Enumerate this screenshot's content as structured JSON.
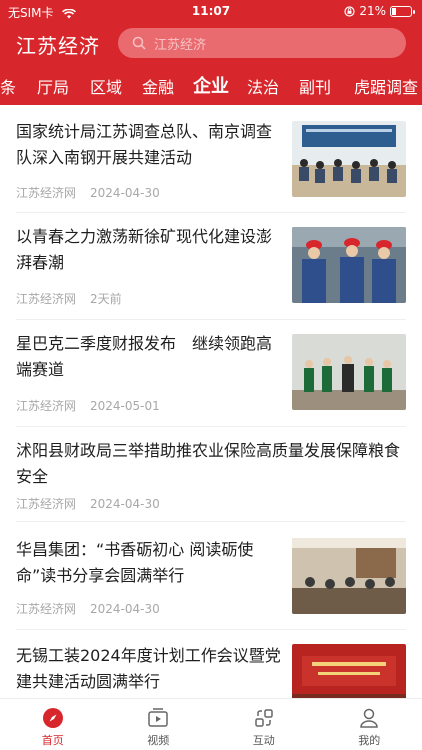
{
  "status_bar": {
    "carrier": "无SIM卡",
    "time": "11:07",
    "battery": "21%",
    "battery_level": 0.21
  },
  "header": {
    "title": "江苏经济",
    "search_placeholder": "江苏经济"
  },
  "tabs": [
    {
      "label": "条"
    },
    {
      "label": "厅局"
    },
    {
      "label": "区域"
    },
    {
      "label": "金融"
    },
    {
      "label": "企业",
      "active": true
    },
    {
      "label": "法治"
    },
    {
      "label": "副刊"
    },
    {
      "label": "虎踞调查"
    }
  ],
  "articles": [
    {
      "title": "国家统计局江苏调查总队、南京调查队深入南钢开展共建活动",
      "source": "江苏经济网",
      "date": "2024-04-30",
      "has_image": true
    },
    {
      "title": "以青春之力激荡新徐矿现代化建设澎湃春潮",
      "source": "江苏经济网",
      "date": "2天前",
      "has_image": true
    },
    {
      "title": "星巴克二季度财报发布　继续领跑高端赛道",
      "source": "江苏经济网",
      "date": "2024-05-01",
      "has_image": true
    },
    {
      "title": "沭阳县财政局三举措助推农业保险高质量发展保障粮食安全",
      "source": "江苏经济网",
      "date": "2024-04-30",
      "has_image": false
    },
    {
      "title": "华昌集团：“书香砺初心 阅读砺使命”读书分享会圆满举行",
      "source": "江苏经济网",
      "date": "2024-04-30",
      "has_image": true
    },
    {
      "title": "无锡工装2024年度计划工作会议暨党建共建活动圆满举行",
      "source": "",
      "date": "",
      "has_image": true
    }
  ],
  "bottom_nav": [
    {
      "label": "首页",
      "icon": "compass-icon",
      "active": true
    },
    {
      "label": "视频",
      "icon": "video-icon",
      "active": false
    },
    {
      "label": "互动",
      "icon": "interact-icon",
      "active": false
    },
    {
      "label": "我的",
      "icon": "profile-icon",
      "active": false
    }
  ],
  "colors": {
    "brand": "#d8272c",
    "meta": "#a8a8a8"
  }
}
